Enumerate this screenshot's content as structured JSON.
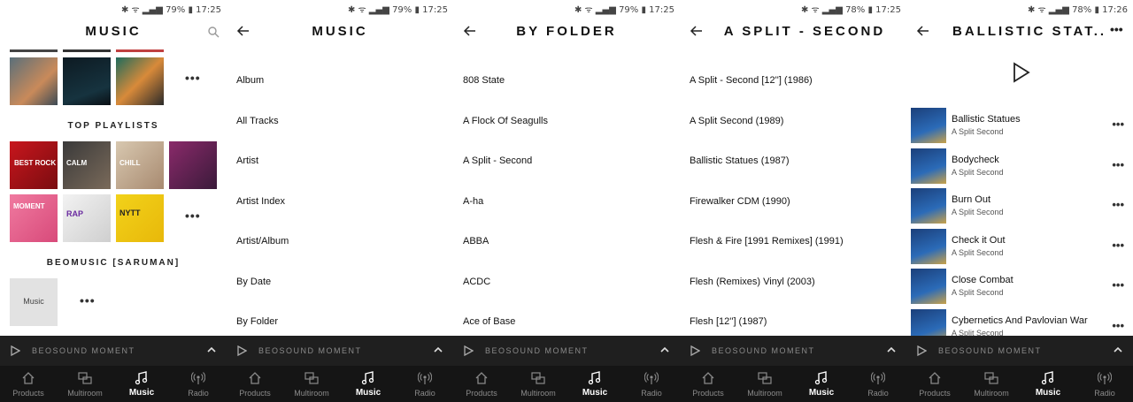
{
  "status": [
    {
      "battery": "79%",
      "time": "17:25"
    },
    {
      "battery": "79%",
      "time": "17:25"
    },
    {
      "battery": "79%",
      "time": "17:25"
    },
    {
      "battery": "78%",
      "time": "17:25"
    },
    {
      "battery": "78%",
      "time": "17:26"
    }
  ],
  "titles": [
    "MUSIC",
    "MUSIC",
    "BY FOLDER",
    "A SPLIT - SECOND",
    "BALLISTIC STAT..."
  ],
  "panel1": {
    "section_top": "TOP PLAYLISTS",
    "section_beo": "BEOMUSIC [SARUMAN]",
    "music_tile": "Music",
    "playlists": [
      "BEST ROCK",
      "CALM",
      "CHILL",
      "",
      "MOMENT",
      "RAP",
      "NYTT",
      ""
    ]
  },
  "panel2": {
    "items": [
      "Album",
      "All Tracks",
      "Artist",
      "Artist Index",
      "Artist/Album",
      "By Date",
      "By Folder"
    ]
  },
  "panel3": {
    "items": [
      "808 State",
      "A Flock Of Seagulls",
      "A Split - Second",
      "A-ha",
      "ABBA",
      "ACDC",
      "Ace of Base"
    ]
  },
  "panel4": {
    "items": [
      "A Split - Second [12''] (1986)",
      "A Split Second (1989)",
      "Ballistic Statues (1987)",
      "Firewalker CDM (1990)",
      "Flesh & Fire [1991 Remixes] (1991)",
      "Flesh (Remixes) Vinyl (2003)",
      "Flesh [12''] (1987)"
    ]
  },
  "panel5": {
    "tracks": [
      {
        "name": "Ballistic Statues",
        "artist": "A Split Second"
      },
      {
        "name": "Bodycheck",
        "artist": "A Split Second"
      },
      {
        "name": "Burn Out",
        "artist": "A Split Second"
      },
      {
        "name": "Check it Out",
        "artist": "A Split Second"
      },
      {
        "name": "Close Combat",
        "artist": "A Split Second"
      },
      {
        "name": "Cybernetics And Pavlovian War",
        "artist": "A Split Second"
      }
    ]
  },
  "player": {
    "name": "BEOSOUND MOMENT"
  },
  "nav": {
    "products": "Products",
    "multiroom": "Multiroom",
    "music": "Music",
    "radio": "Radio"
  },
  "colors": {
    "player_bg": "#1f1f1f",
    "nav_bg": "#151515",
    "active": "#ffffff",
    "inactive": "#8a8a8a"
  }
}
